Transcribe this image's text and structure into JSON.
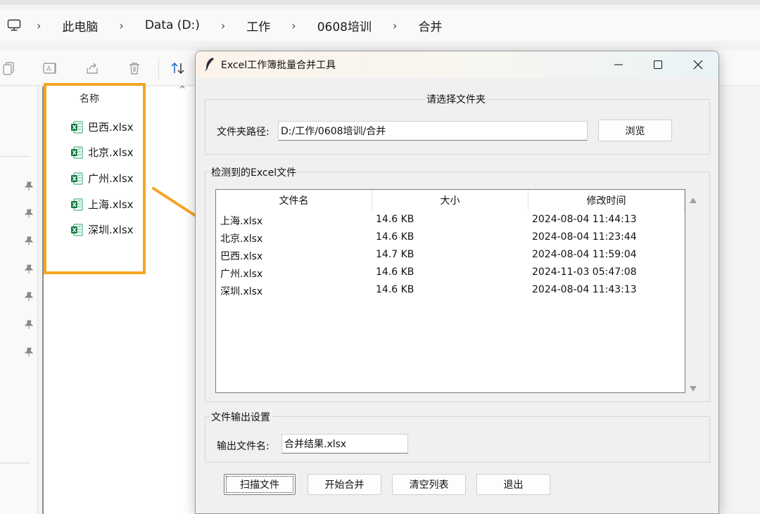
{
  "explorer": {
    "breadcrumb": [
      "此电脑",
      "Data (D:)",
      "工作",
      "0608培训",
      "合并"
    ],
    "column_name": "名称",
    "files": [
      "巴西.xlsx",
      "北京.xlsx",
      "广州.xlsx",
      "上海.xlsx",
      "深圳.xlsx"
    ],
    "highlight_color": "#f5a623"
  },
  "dialog": {
    "title": "Excel工作簿批量合并工具",
    "folder_group": {
      "title": "请选择文件夹",
      "path_label": "文件夹路径:",
      "path_value": "D:/工作/0608培训/合并",
      "browse_label": "浏览"
    },
    "files_group": {
      "title": "检测到的Excel文件",
      "columns": [
        "文件名",
        "大小",
        "修改时间"
      ],
      "rows": [
        {
          "name": "上海.xlsx",
          "size": "14.6 KB",
          "modified": "2024-08-04 11:44:13"
        },
        {
          "name": "北京.xlsx",
          "size": "14.6 KB",
          "modified": "2024-08-04 11:23:44"
        },
        {
          "name": "巴西.xlsx",
          "size": "14.7 KB",
          "modified": "2024-08-04 11:59:04"
        },
        {
          "name": "广州.xlsx",
          "size": "14.6 KB",
          "modified": "2024-11-03 05:47:08"
        },
        {
          "name": "深圳.xlsx",
          "size": "14.6 KB",
          "modified": "2024-08-04 11:43:13"
        }
      ]
    },
    "output_group": {
      "title": "文件输出设置",
      "filename_label": "输出文件名:",
      "filename_value": "合并结果.xlsx"
    },
    "buttons": {
      "scan": "扫描文件",
      "merge": "开始合并",
      "clear": "清空列表",
      "exit": "退出"
    }
  }
}
